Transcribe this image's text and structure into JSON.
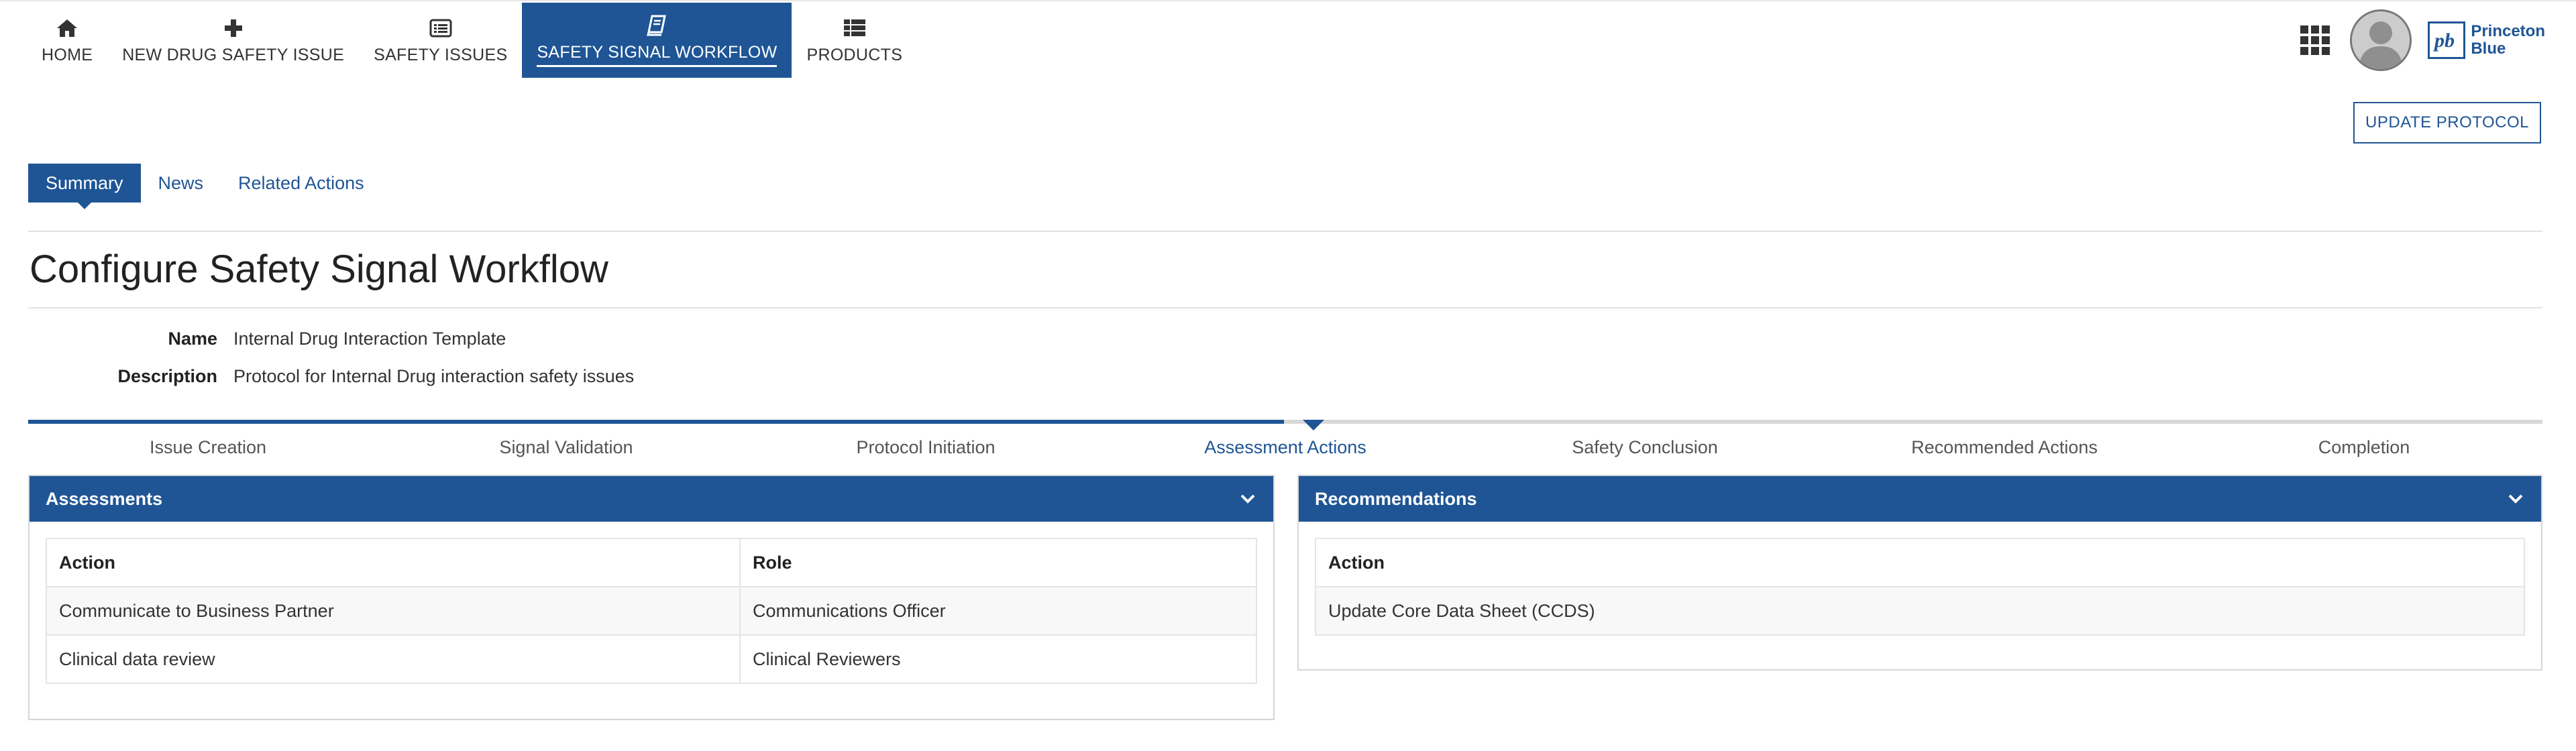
{
  "nav": {
    "items": [
      {
        "label": "HOME",
        "icon": "home-icon"
      },
      {
        "label": "NEW DRUG SAFETY ISSUE",
        "icon": "plus-icon"
      },
      {
        "label": "SAFETY ISSUES",
        "icon": "list-card-icon"
      },
      {
        "label": "SAFETY SIGNAL WORKFLOW",
        "icon": "book-icon",
        "active": true
      },
      {
        "label": "PRODUCTS",
        "icon": "grid-list-icon"
      }
    ]
  },
  "header": {
    "logo_line1": "Princeton",
    "logo_line2": "Blue",
    "logo_mark": "pb"
  },
  "actions": {
    "update_protocol": "UPDATE PROTOCOL"
  },
  "subtabs": [
    "Summary",
    "News",
    "Related Actions"
  ],
  "page": {
    "title": "Configure Safety Signal Workflow",
    "name_label": "Name",
    "name_value": "Internal Drug Interaction Template",
    "description_label": "Description",
    "description_value": "Protocol for Internal Drug interaction safety issues"
  },
  "steps": [
    "Issue Creation",
    "Signal Validation",
    "Protocol Initiation",
    "Assessment Actions",
    "Safety Conclusion",
    "Recommended Actions",
    "Completion"
  ],
  "current_step": "Assessment Actions",
  "assessments": {
    "title": "Assessments",
    "columns": [
      "Action",
      "Role"
    ],
    "rows": [
      [
        "Communicate to Business Partner",
        "Communications Officer"
      ],
      [
        "Clinical data review",
        "Clinical Reviewers"
      ]
    ]
  },
  "recommendations": {
    "title": "Recommendations",
    "columns": [
      "Action"
    ],
    "rows": [
      [
        "Update Core Data Sheet (CCDS)"
      ]
    ]
  },
  "colors": {
    "primary": "#1f5595",
    "border": "#d6d6d6"
  }
}
